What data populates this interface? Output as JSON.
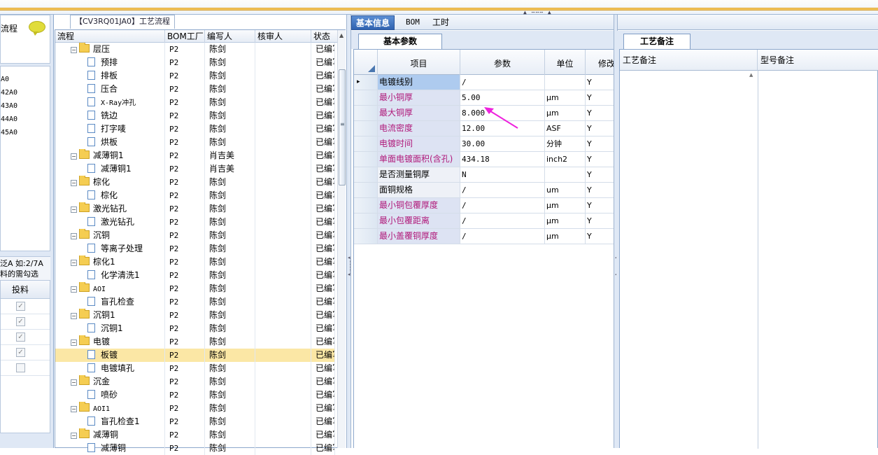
{
  "left_panel": {
    "header_text": "流程",
    "list_items": [
      "A0",
      "42A0",
      "43A0",
      "44A0",
      "45A0"
    ],
    "note_line1": "泛A 如:2/7A",
    "note_line2": "料的需勾选",
    "grid_header": "投料",
    "checkbox_states": [
      true,
      true,
      true,
      true,
      false
    ]
  },
  "tree_panel": {
    "title": "【CV3RQ01JA0】工艺流程",
    "columns": [
      "流程",
      "BOM工厂",
      "编写人",
      "核审人",
      "状态"
    ],
    "rows": [
      {
        "type": "group",
        "label": "层压",
        "bom": "P2",
        "writer": "陈剑",
        "reviewer": "",
        "status": "已编写"
      },
      {
        "type": "item",
        "label": "预排",
        "bom": "P2",
        "writer": "陈剑",
        "reviewer": "",
        "status": "已编写"
      },
      {
        "type": "item",
        "label": "排板",
        "bom": "P2",
        "writer": "陈剑",
        "reviewer": "",
        "status": "已编写"
      },
      {
        "type": "item",
        "label": "压合",
        "bom": "P2",
        "writer": "陈剑",
        "reviewer": "",
        "status": "已编写"
      },
      {
        "type": "item",
        "label": "X-Ray冲孔",
        "bom": "P2",
        "writer": "陈剑",
        "reviewer": "",
        "status": "已编写"
      },
      {
        "type": "item",
        "label": "铣边",
        "bom": "P2",
        "writer": "陈剑",
        "reviewer": "",
        "status": "已编写"
      },
      {
        "type": "item",
        "label": "打字唛",
        "bom": "P2",
        "writer": "陈剑",
        "reviewer": "",
        "status": "已编写"
      },
      {
        "type": "item",
        "label": "烘板",
        "bom": "P2",
        "writer": "陈剑",
        "reviewer": "",
        "status": "已编写"
      },
      {
        "type": "group",
        "label": "减薄铜1",
        "bom": "P2",
        "writer": "肖吉美",
        "reviewer": "",
        "status": "已编写"
      },
      {
        "type": "item",
        "label": "减薄铜1",
        "bom": "P2",
        "writer": "肖吉美",
        "reviewer": "",
        "status": "已编写"
      },
      {
        "type": "group",
        "label": "棕化",
        "bom": "P2",
        "writer": "陈剑",
        "reviewer": "",
        "status": "已编写"
      },
      {
        "type": "item",
        "label": "棕化",
        "bom": "P2",
        "writer": "陈剑",
        "reviewer": "",
        "status": "已编写"
      },
      {
        "type": "group",
        "label": "激光钻孔",
        "bom": "P2",
        "writer": "陈剑",
        "reviewer": "",
        "status": "已编写"
      },
      {
        "type": "item",
        "label": "激光钻孔",
        "bom": "P2",
        "writer": "陈剑",
        "reviewer": "",
        "status": "已编写"
      },
      {
        "type": "group",
        "label": "沉铜",
        "bom": "P2",
        "writer": "陈剑",
        "reviewer": "",
        "status": "已编写"
      },
      {
        "type": "item",
        "label": "等离子处理",
        "bom": "P2",
        "writer": "陈剑",
        "reviewer": "",
        "status": "已编写"
      },
      {
        "type": "group",
        "label": "棕化1",
        "bom": "P2",
        "writer": "陈剑",
        "reviewer": "",
        "status": "已编写"
      },
      {
        "type": "item",
        "label": "化学清洗1",
        "bom": "P2",
        "writer": "陈剑",
        "reviewer": "",
        "status": "已编写"
      },
      {
        "type": "group",
        "label": "AOI",
        "bom": "P2",
        "writer": "陈剑",
        "reviewer": "",
        "status": "已编写"
      },
      {
        "type": "item",
        "label": "盲孔检查",
        "bom": "P2",
        "writer": "陈剑",
        "reviewer": "",
        "status": "已编写"
      },
      {
        "type": "group",
        "label": "沉铜1",
        "bom": "P2",
        "writer": "陈剑",
        "reviewer": "",
        "status": "已编写"
      },
      {
        "type": "item",
        "label": "沉铜1",
        "bom": "P2",
        "writer": "陈剑",
        "reviewer": "",
        "status": "已编写"
      },
      {
        "type": "group",
        "label": "电镀",
        "bom": "P2",
        "writer": "陈剑",
        "reviewer": "",
        "status": "已编写"
      },
      {
        "type": "item",
        "label": "板镀",
        "bom": "P2",
        "writer": "陈剑",
        "reviewer": "",
        "status": "已编写",
        "selected": true
      },
      {
        "type": "item",
        "label": "电镀填孔",
        "bom": "P2",
        "writer": "陈剑",
        "reviewer": "",
        "status": "已编写"
      },
      {
        "type": "group",
        "label": "沉金",
        "bom": "P2",
        "writer": "陈剑",
        "reviewer": "",
        "status": "已编写"
      },
      {
        "type": "item",
        "label": "喷砂",
        "bom": "P2",
        "writer": "陈剑",
        "reviewer": "",
        "status": "已编写"
      },
      {
        "type": "group",
        "label": "AOI1",
        "bom": "P2",
        "writer": "陈剑",
        "reviewer": "",
        "status": "已编写"
      },
      {
        "type": "item",
        "label": "盲孔检查1",
        "bom": "P2",
        "writer": "陈剑",
        "reviewer": "",
        "status": "已编写"
      },
      {
        "type": "group",
        "label": "减薄铜",
        "bom": "P2",
        "writer": "陈剑",
        "reviewer": "",
        "status": "已编写"
      },
      {
        "type": "item",
        "label": "减薄铜",
        "bom": "P2",
        "writer": "陈剑",
        "reviewer": "",
        "status": "已编写"
      }
    ]
  },
  "tabs": {
    "main": [
      "基本信息",
      "BOM",
      "工时"
    ],
    "active": 0,
    "sub": "基本参数",
    "notes_tab": "工艺备注"
  },
  "param_grid": {
    "columns": [
      "项目",
      "参数",
      "单位",
      "修改"
    ],
    "rows": [
      {
        "name": "电镀线别",
        "value": "/",
        "unit": "",
        "mod": "Y",
        "highlight": "blue",
        "current": true
      },
      {
        "name": "最小铜厚",
        "value": "5.00",
        "unit": "μm",
        "mod": "Y",
        "highlight": "red"
      },
      {
        "name": "最大铜厚",
        "value": "8.000",
        "unit": "μm",
        "mod": "Y",
        "highlight": "red"
      },
      {
        "name": "电流密度",
        "value": "12.00",
        "unit": "ASF",
        "mod": "Y",
        "highlight": "red"
      },
      {
        "name": "电镀时间",
        "value": "30.00",
        "unit": "分钟",
        "mod": "Y",
        "highlight": "red"
      },
      {
        "name": "单面电镀面积(含孔)",
        "value": "434.18",
        "unit": "inch2",
        "mod": "Y",
        "highlight": "red"
      },
      {
        "name": "是否测量铜厚",
        "value": "N",
        "unit": "",
        "mod": "Y",
        "highlight": "none"
      },
      {
        "name": "面铜规格",
        "value": "/",
        "unit": "um",
        "mod": "Y",
        "highlight": "none"
      },
      {
        "name": "最小铜包覆厚度",
        "value": "/",
        "unit": "μm",
        "mod": "Y",
        "highlight": "red"
      },
      {
        "name": "最小包覆距离",
        "value": "/",
        "unit": "μm",
        "mod": "Y",
        "highlight": "red"
      },
      {
        "name": "最小盖覆铜厚度",
        "value": "/",
        "unit": "μm",
        "mod": "Y",
        "highlight": "red"
      }
    ]
  },
  "notes_grid": {
    "columns": [
      "工艺备注",
      "型号备注"
    ]
  },
  "colors": {
    "highlight_red_text": "#b0197a",
    "highlight_bg": "#dde3f3",
    "highlight_blue_bg": "#aecbef",
    "annotation_arrow": "#ee22dd",
    "selected_row": "#fbe7a5"
  }
}
